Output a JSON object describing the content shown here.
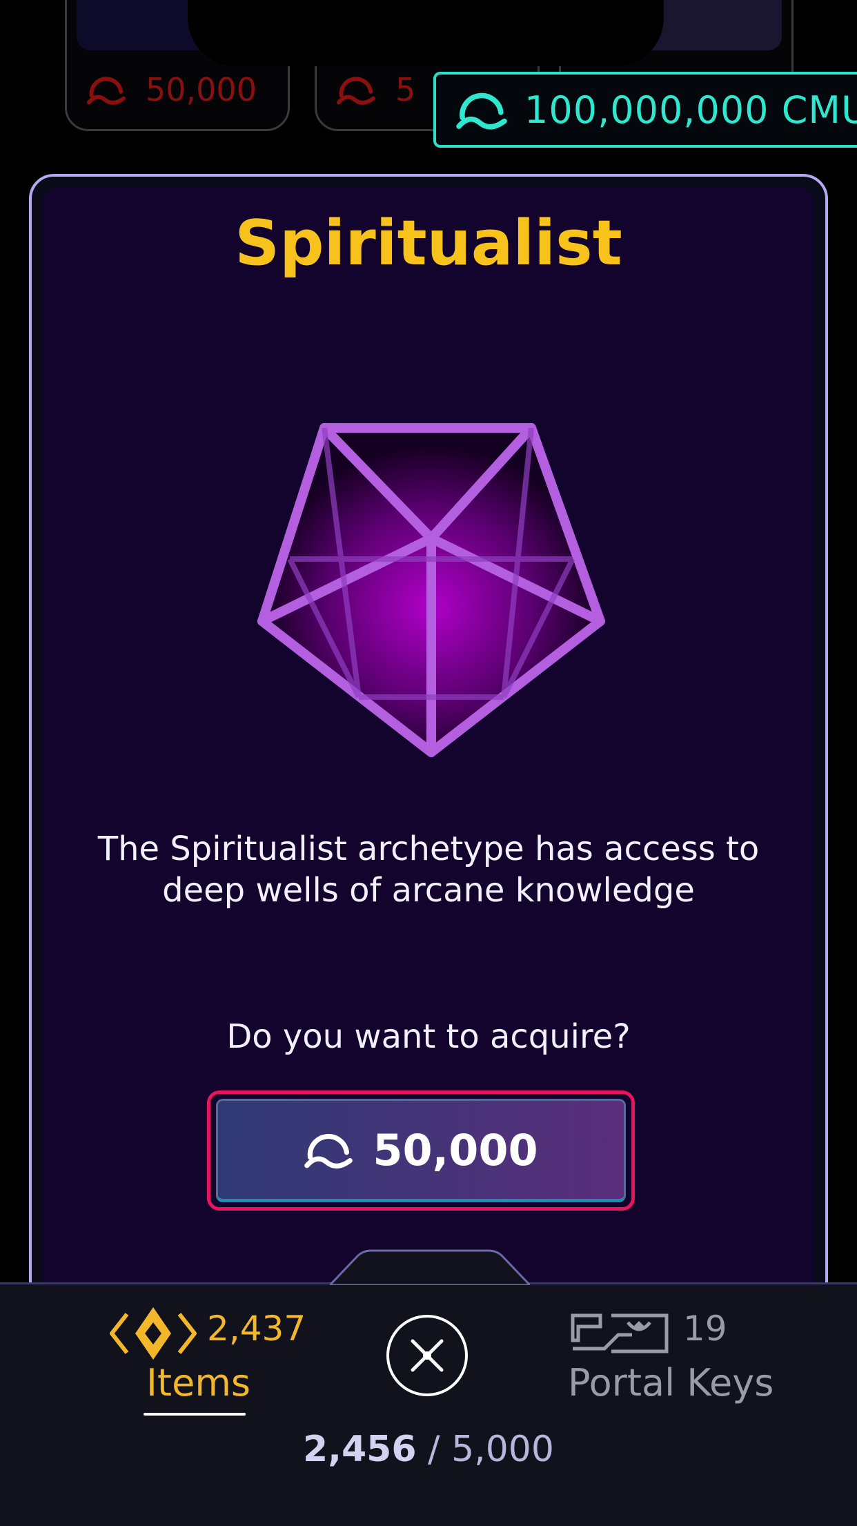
{
  "background_cards": [
    {
      "price": "50,000"
    },
    {
      "price": "5"
    }
  ],
  "balance": {
    "amount": "100,000,000 CMU",
    "icon": "cmu-currency-icon"
  },
  "modal": {
    "title": "Spiritualist",
    "description": "The Spiritualist archetype has access to deep wells of arcane knowledge",
    "question": "Do you want to acquire?",
    "price": "50,000",
    "gem_icon": "icosahedron-gem-icon"
  },
  "bottom_bar": {
    "items": {
      "count": "2,437",
      "label": "Items"
    },
    "portal_keys": {
      "count": "19",
      "label": "Portal Keys"
    },
    "capacity": {
      "used": "2,456",
      "separator": "/",
      "total": "5,000"
    }
  },
  "colors": {
    "title": "#f7c21b",
    "balance": "#2fe6cf",
    "buy_border": "#e8155e",
    "items_accent": "#f2b72a",
    "gem": "#b040e0"
  }
}
